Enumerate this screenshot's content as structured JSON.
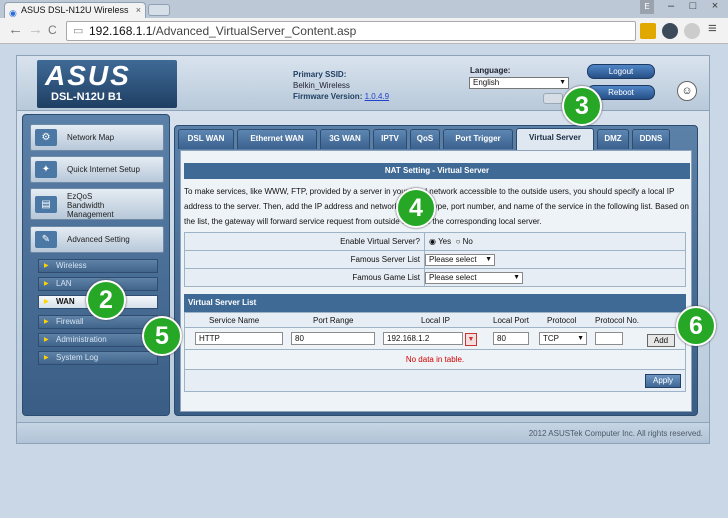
{
  "browser": {
    "tab_title": "ASUS DSL-N12U Wireless",
    "tab_close": "×",
    "window_user": "E",
    "window_min": "–",
    "window_max": "□",
    "window_close": "×",
    "back": "←",
    "forward": "→",
    "reload": "C",
    "url_host": "192.168.1.1",
    "url_path": "/Advanced_VirtualServer_Content.asp",
    "menu": "≡"
  },
  "header": {
    "logo": "ASUS",
    "model": "DSL-N12U B1",
    "ssid_label": "Primary SSID:",
    "ssid_value": "Belkin_Wireless",
    "firmware_label": "Firmware Version:",
    "firmware_value": "1.0.4.9",
    "language_label": "Language:",
    "language_value": "English",
    "logout": "Logout",
    "reboot": "Reboot"
  },
  "sidebar": {
    "main_items": [
      {
        "label": "Network Map"
      },
      {
        "label": "Quick Internet Setup"
      },
      {
        "label_lines": [
          "EzQoS",
          "Bandwidth",
          "Management"
        ]
      },
      {
        "label": "Advanced Setting"
      }
    ],
    "sub_items": [
      {
        "label": "Wireless",
        "active": false
      },
      {
        "label": "LAN",
        "active": false
      },
      {
        "label": "WAN",
        "active": true
      },
      {
        "label": "Firewall",
        "active": false
      },
      {
        "label": "Administration",
        "active": false
      },
      {
        "label": "System Log",
        "active": false
      }
    ]
  },
  "tabs": [
    {
      "label": "DSL WAN",
      "active": false
    },
    {
      "label": "Ethernet WAN",
      "active": false
    },
    {
      "label": "3G WAN",
      "active": false
    },
    {
      "label": "IPTV",
      "active": false
    },
    {
      "label": "QoS",
      "active": false
    },
    {
      "label": "Port Trigger",
      "active": false
    },
    {
      "label": "Virtual Server",
      "active": true
    },
    {
      "label": "DMZ",
      "active": false
    },
    {
      "label": "DDNS",
      "active": false
    }
  ],
  "panel": {
    "title": "NAT Setting - Virtual Server",
    "description": "To make services, like WWW, FTP, provided by a server in your local network accessible to the outside users, you should specify a local IP address to the server. Then, add the IP address and network protocol type, port number, and name of the service in the following list. Based on the list, the gateway will forward service request from outside users to the corresponding local server.",
    "enable_label": "Enable Virtual Server?",
    "enable_yes": "Yes",
    "enable_no": "No",
    "famous_server_label": "Famous Server List",
    "famous_server_value": "Please select",
    "famous_game_label": "Famous Game List",
    "famous_game_value": "Please select",
    "list_title": "Virtual Server List",
    "columns": [
      "Service Name",
      "Port Range",
      "Local IP",
      "Local Port",
      "Protocol",
      "Protocol No."
    ],
    "input_row": {
      "service_name": "HTTP",
      "port_range": "80",
      "local_ip": "192.168.1.2",
      "local_port": "80",
      "protocol": "TCP",
      "protocol_no": ""
    },
    "add": "Add",
    "no_data": "No data in table.",
    "apply": "Apply"
  },
  "footer": {
    "copyright": "2012 ASUSTek Computer Inc. All rights reserved."
  },
  "callouts": [
    "2",
    "3",
    "4",
    "5",
    "6"
  ]
}
